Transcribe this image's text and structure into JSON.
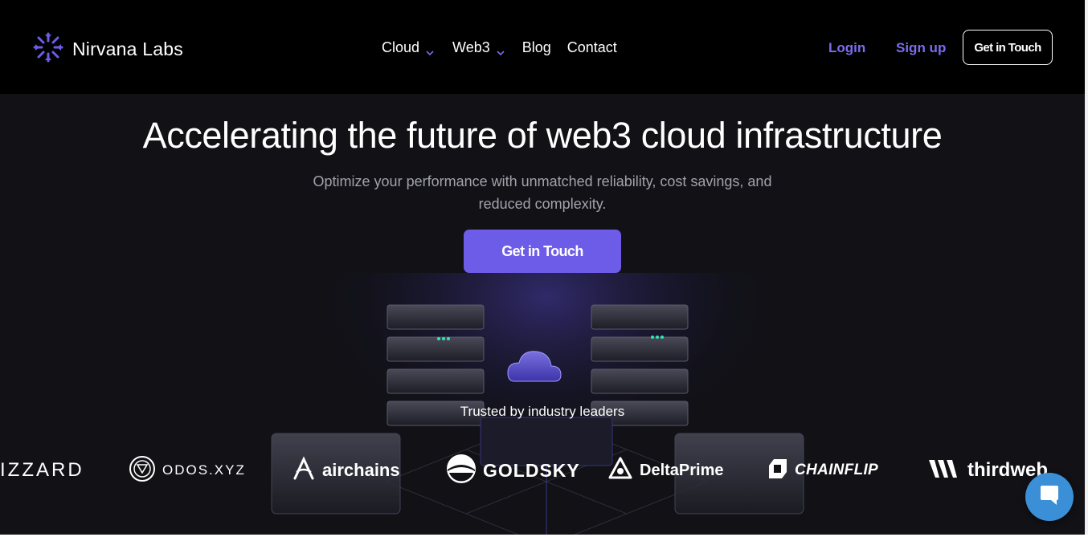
{
  "brand": {
    "name": "Nirvana Labs",
    "icon": "nirvana-logo-icon",
    "accent": "#6c5ce7"
  },
  "nav": {
    "items": [
      {
        "label": "Cloud",
        "dropdown": true
      },
      {
        "label": "Web3",
        "dropdown": true
      },
      {
        "label": "Blog",
        "dropdown": false
      },
      {
        "label": "Contact",
        "dropdown": false
      }
    ],
    "login_label": "Login",
    "signup_label": "Sign up",
    "cta_label": "Get in Touch"
  },
  "hero": {
    "title": "Accelerating the future of web3 cloud infrastructure",
    "subtitle": "Optimize your performance with unmatched reliability, cost savings, and reduced complexity.",
    "cta_label": "Get in Touch",
    "illustration": "cloud-servers-illustration"
  },
  "trusted": {
    "heading": "Trusted by industry leaders",
    "logos": [
      {
        "text": "IZZARD",
        "icon": ""
      },
      {
        "text": "ODOS.XYZ",
        "icon": "odos-logo-icon"
      },
      {
        "text": "airchains",
        "icon": "airchains-logo-icon"
      },
      {
        "text": "GOLDSKY",
        "icon": "goldsky-logo-icon"
      },
      {
        "text": "DeltaPrime",
        "icon": "deltaprime-logo-icon"
      },
      {
        "text": "CHAINFLIP",
        "icon": "chainflip-logo-icon"
      },
      {
        "text": "thirdweb",
        "icon": "thirdweb-logo-icon"
      }
    ]
  },
  "chat": {
    "icon": "chat-bubble-icon",
    "color": "#3b8fd6"
  }
}
